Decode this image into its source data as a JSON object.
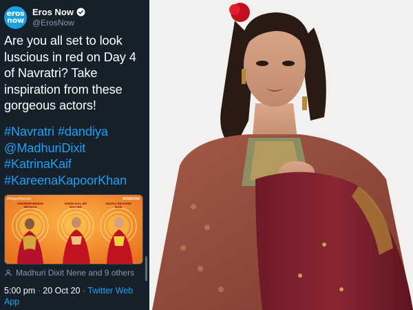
{
  "tweet": {
    "avatar_line1": "eros",
    "avatar_line2": "now",
    "display_name": "Eros Now",
    "handle": "@ErosNow",
    "text": "Are you all set to look luscious in red on Day 4 of Navratri? Take inspiration from these gorgeous actors!",
    "hashtags": [
      "#Navratri #dandiya",
      "@MadhuriDixit",
      "#KatrinaKaif",
      "#KareenaKapoorKhan"
    ],
    "media": {
      "tag": "#HappyNavratri",
      "brand": "erosnow",
      "labels": [
        "CHANDRAMUKHI DEVDAS",
        "SONIA KAL HO NAA HO",
        "ANJALI DE DANA DAN"
      ]
    },
    "likes_text": "Madhuri Dixit Nene and 9 others",
    "time": "5:00 pm",
    "date": "20 Oct 20",
    "app": "Twitter Web App"
  },
  "colors": {
    "tweet_bg": "#15202b",
    "link": "#1da1f2",
    "muted": "#8899a6",
    "avatar": "#1a9fe0",
    "saree": "#7a1d2b"
  },
  "icons": [
    "verified-icon",
    "more-icon",
    "person-icon"
  ]
}
